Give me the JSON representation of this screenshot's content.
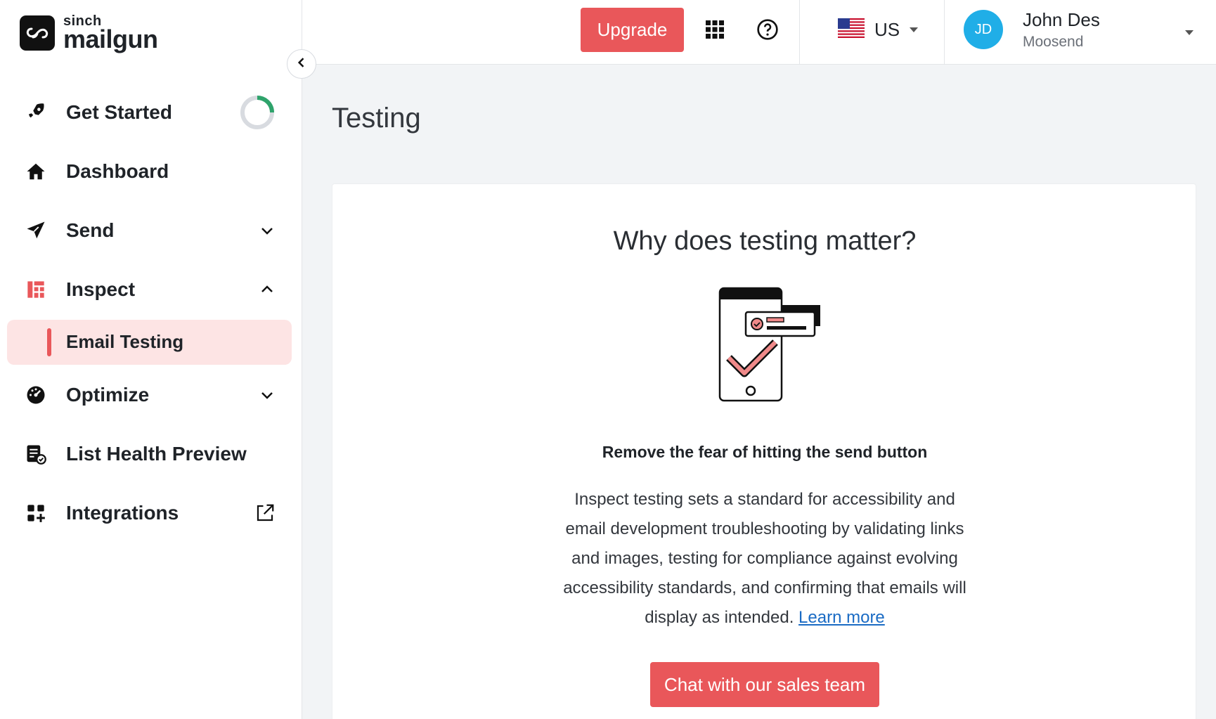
{
  "brand": {
    "top": "sinch",
    "name": "mailgun"
  },
  "colors": {
    "accent": "#e9575a",
    "active_bg": "#fde4e4",
    "avatar": "#20aee7",
    "link": "#1a6bc4"
  },
  "sidebar": {
    "items": [
      {
        "label": "Get Started",
        "icon": "rocket-icon",
        "progress": 0.25
      },
      {
        "label": "Dashboard",
        "icon": "home-icon"
      },
      {
        "label": "Send",
        "icon": "paper-plane-icon",
        "state": "collapsed"
      },
      {
        "label": "Inspect",
        "icon": "inspect-grid-icon",
        "state": "expanded"
      },
      {
        "label": "Optimize",
        "icon": "gauge-icon",
        "state": "collapsed"
      },
      {
        "label": "List Health Preview",
        "icon": "list-check-icon"
      },
      {
        "label": "Integrations",
        "icon": "apps-plus-icon",
        "external": true
      }
    ],
    "sub_items": [
      {
        "label": "Email Testing",
        "active": true
      }
    ]
  },
  "header": {
    "upgrade_label": "Upgrade",
    "region": "US",
    "user": {
      "initials": "JD",
      "name": "John Des",
      "org": "Moosend"
    }
  },
  "page": {
    "title": "Testing"
  },
  "card": {
    "heading": "Why does testing matter?",
    "subheading": "Remove the fear of hitting the send button",
    "body": "Inspect testing sets a standard for accessibility and email development troubleshooting by validating links and images, testing for compliance against evolving accessibility standards, and confirming that emails will display as intended.",
    "link_label": "Learn more",
    "cta_label": "Chat with our sales team"
  }
}
